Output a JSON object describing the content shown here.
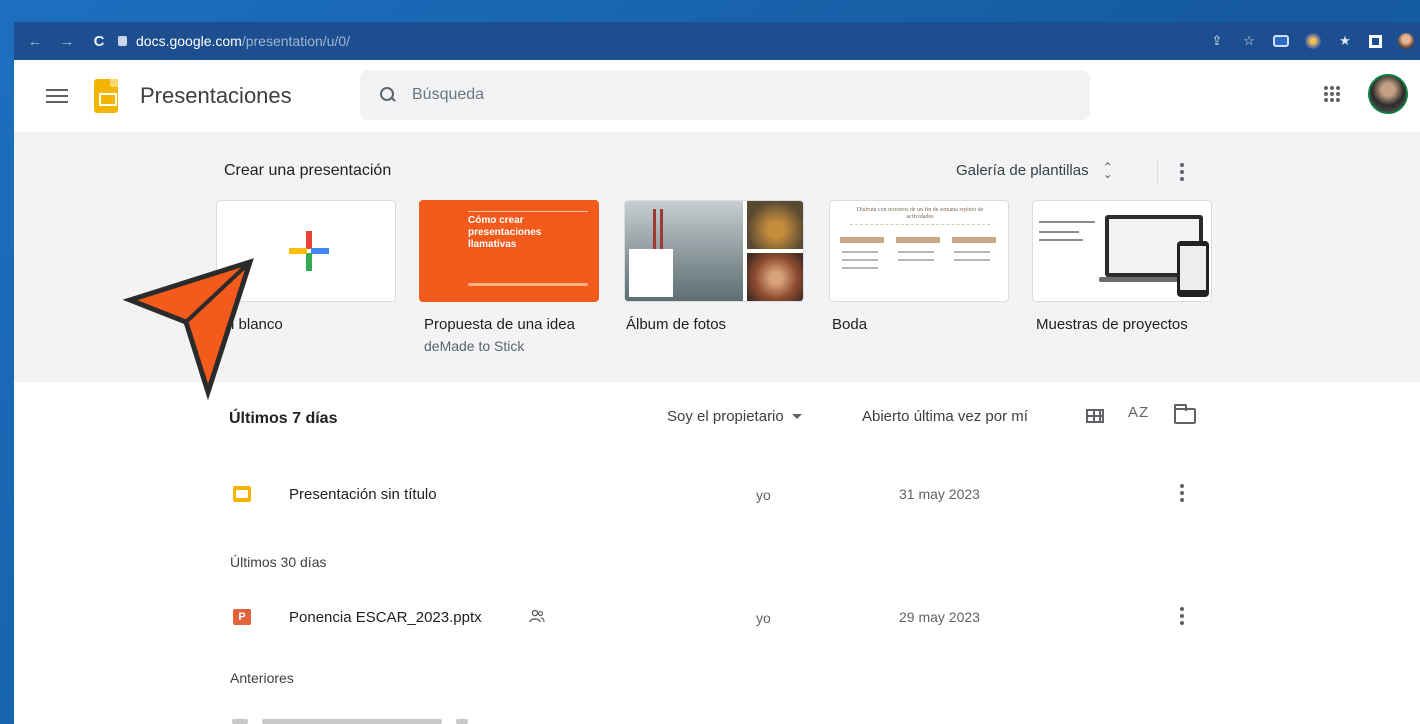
{
  "browser": {
    "url_host": "docs.google.com",
    "url_path": "/presentation/u/0/",
    "nav": {
      "back": "←",
      "forward": "→",
      "reload": "C"
    }
  },
  "app": {
    "title": "Presentaciones",
    "search_placeholder": "Búsqueda"
  },
  "gallery": {
    "title": "Crear una presentación",
    "gallery_link": "Galería de plantillas",
    "templates": [
      {
        "label": "En blanco",
        "sub": ""
      },
      {
        "label": "Propuesta de una idea",
        "sub": "deMade to Stick",
        "thumb_text": "Cómo crear presentaciones llamativas"
      },
      {
        "label": "Álbum de fotos",
        "sub": ""
      },
      {
        "label": "Boda",
        "sub": "",
        "thumb_text": "Disfruta con nosotros de un fin de semana repleto de actividades"
      },
      {
        "label": "Muestras de proyectos",
        "sub": ""
      }
    ]
  },
  "list": {
    "heading": "Últimos 7 días",
    "owner_filter": "Soy el propietario",
    "sort_label": "Abierto última vez por mí",
    "sort_icon": "AZ",
    "sections": [
      "Últimos 30 días",
      "Anteriores"
    ],
    "rows": [
      {
        "name": "Presentación sin título",
        "owner": "yo",
        "date": "31 may 2023",
        "icon": "slides-file-icon",
        "shared": false
      },
      {
        "name": "Ponencia ESCAR_2023.pptx",
        "owner": "yo",
        "date": "29 may 2023",
        "icon": "powerpoint-file-icon",
        "shared": true,
        "icon_letter": "P"
      }
    ]
  },
  "colors": {
    "accent_orange": "#f35b1c",
    "slides_yellow": "#f4b400",
    "ppt_orange": "#e0633b",
    "frame_blue": "#1b67b4"
  }
}
